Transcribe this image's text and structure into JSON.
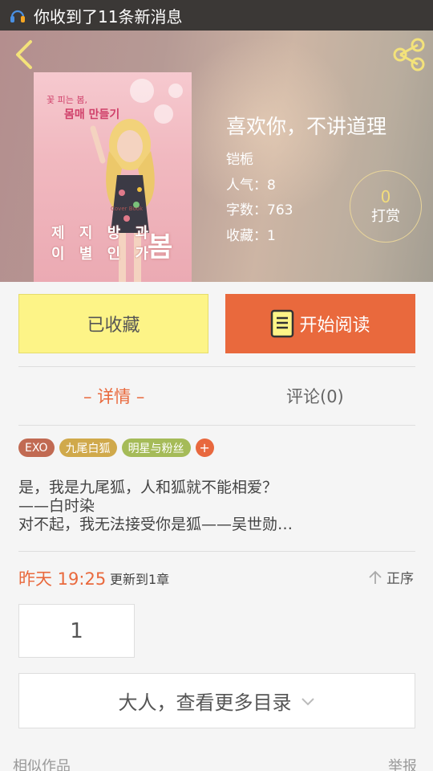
{
  "status_bar": {
    "notification": "你收到了11条新消息"
  },
  "cover": {
    "line1": "꽃 피는 봄,",
    "line2": "몸매 만들기",
    "line3": "제 지 방 과",
    "line4": "이 별 인 가",
    "big": "봄",
    "small": "Cover Book"
  },
  "book": {
    "title": "喜欢你，不讲道理",
    "author": "铠栀",
    "popularity": "人气：8",
    "word_count": "字数：763",
    "favorites": "收藏：1"
  },
  "reward": {
    "value": "0",
    "label": "打赏"
  },
  "actions": {
    "collected": "已收藏",
    "read": "开始阅读"
  },
  "tabs": {
    "details": "– 详情 –",
    "comments": "评论(0)"
  },
  "tags": [
    "EXO",
    "九尾白狐",
    "明星与粉丝",
    "+"
  ],
  "description": [
    "是，我是九尾狐，人和狐就不能相爱？",
    "——白时染",
    "对不起，我无法接受你是狐——吴世勋…"
  ],
  "update": {
    "time": "昨天 19:25",
    "text": "更新到1章",
    "order": "正序"
  },
  "chapter_button": "1",
  "more_catalog": "大人，查看更多目录",
  "footer": {
    "similar": "相似作品",
    "report": "举报"
  },
  "colors": {
    "accent": "#e9693d",
    "collected_bg": "#fdf487",
    "status_bar": "#3b3836"
  },
  "icons": [
    "notification-icon",
    "back-icon",
    "share-icon",
    "book-icon",
    "sort-arrow-icon",
    "chevron-down-icon"
  ]
}
